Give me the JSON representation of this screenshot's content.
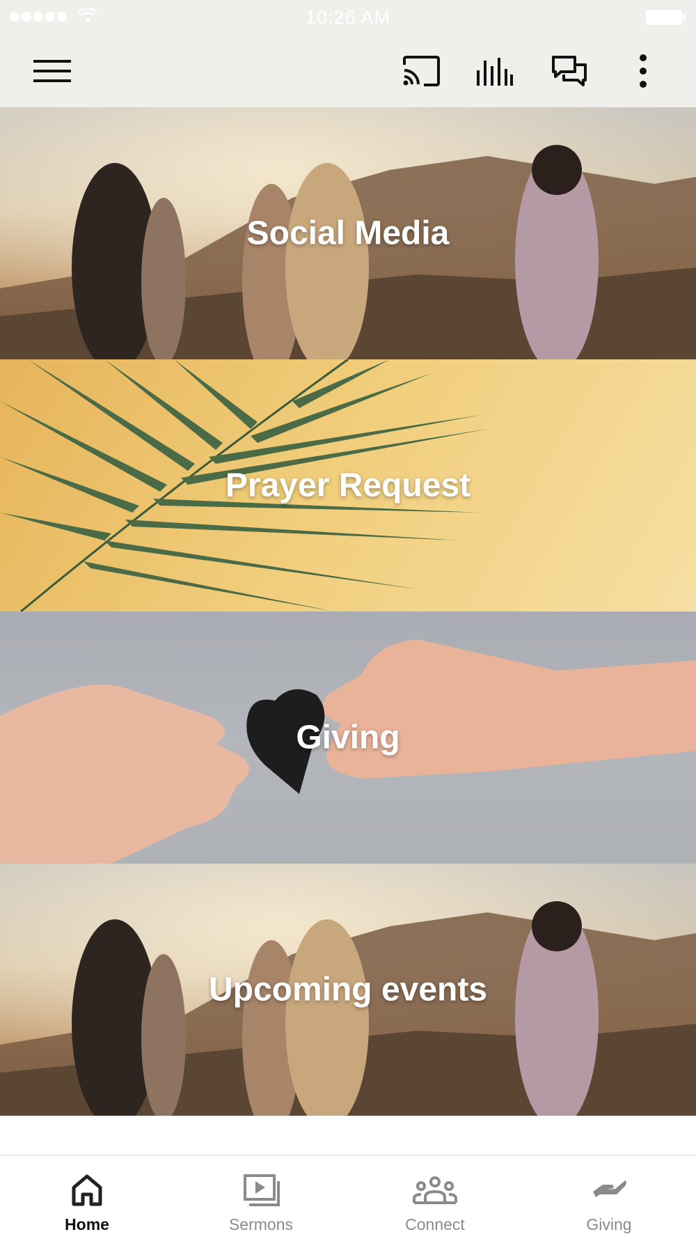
{
  "status_bar": {
    "time": "10:26 AM",
    "signal_icon": "signal-dots-icon",
    "wifi_icon": "wifi-icon",
    "battery_icon": "battery-icon"
  },
  "toolbar": {
    "menu_icon": "hamburger-menu-icon",
    "actions": [
      {
        "name": "cast-icon"
      },
      {
        "name": "audio-bars-icon"
      },
      {
        "name": "chat-bubbles-icon"
      },
      {
        "name": "more-vertical-icon"
      }
    ]
  },
  "tiles": [
    {
      "label": "Social Media",
      "image": "friends-sunset-hills"
    },
    {
      "label": "Prayer Request",
      "image": "palm-leaf-yellow-wall"
    },
    {
      "label": "Giving",
      "image": "hands-passing-paper-heart"
    },
    {
      "label": "Upcoming events",
      "image": "friends-sunset-hills"
    }
  ],
  "bottom_nav": {
    "items": [
      {
        "label": "Home",
        "icon": "home-icon",
        "active": true
      },
      {
        "label": "Sermons",
        "icon": "video-library-icon",
        "active": false
      },
      {
        "label": "Connect",
        "icon": "people-group-icon",
        "active": false
      },
      {
        "label": "Giving",
        "icon": "giving-hand-icon",
        "active": false
      }
    ]
  },
  "colors": {
    "toolbar_bg": "#efefeb",
    "nav_active": "#111111",
    "nav_inactive": "#8a8a8a"
  }
}
